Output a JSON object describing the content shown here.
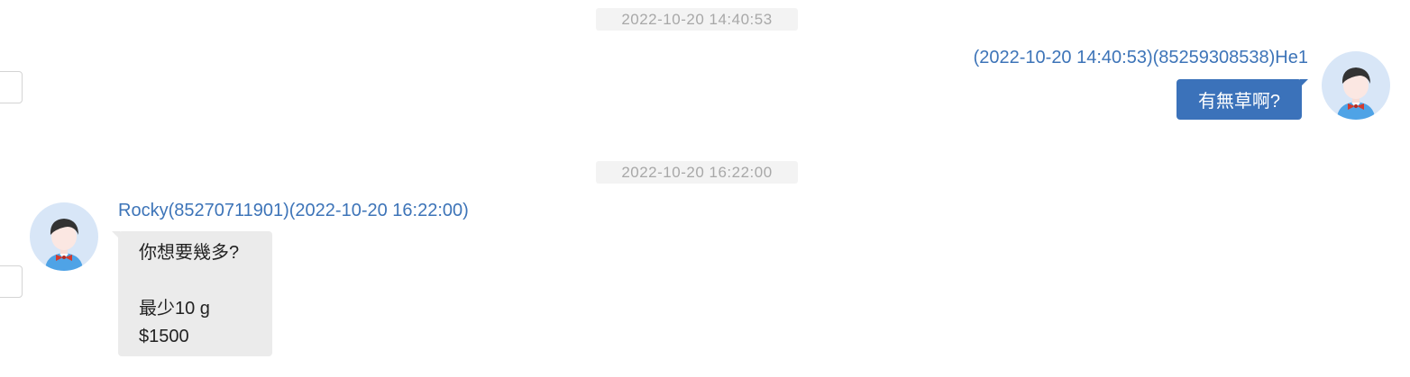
{
  "messages": [
    {
      "timestamp": "2022-10-20 14:40:53",
      "direction": "outgoing",
      "sender_line": "(2022-10-20 14:40:53)(85259308538)He1",
      "text": "有無草啊?",
      "avatar_icon": "user-avatar-icon"
    },
    {
      "timestamp": "2022-10-20 16:22:00",
      "direction": "incoming",
      "sender_line": "Rocky(85270711901)(2022-10-20 16:22:00)",
      "text": "你想要幾多?\n\n最少10 g\n$1500",
      "avatar_icon": "user-avatar-icon"
    }
  ],
  "colors": {
    "sender": "#3d74b8",
    "outgoing_bubble": "#3b72ba",
    "incoming_bubble": "#ebebeb",
    "timestamp_text": "#a8a8a8",
    "timestamp_bg": "#f3f3f3"
  }
}
